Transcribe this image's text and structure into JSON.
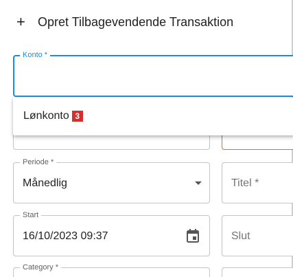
{
  "dialog": {
    "title": "Opret Tilbagevendende Transaktion"
  },
  "form": {
    "konto": {
      "label": "Konto *",
      "value": ""
    },
    "dropdown": {
      "options": [
        {
          "label": "Lønkonto",
          "badge": "3"
        }
      ]
    },
    "periode": {
      "label": "Periode *",
      "value": "Månedlig"
    },
    "titel": {
      "placeholder": "Titel *"
    },
    "start": {
      "label": "Start",
      "value": "16/10/2023 09:37"
    },
    "slut": {
      "placeholder": "Slut"
    },
    "category": {
      "label": "Category *"
    }
  },
  "icons": {
    "title_icon": "plus-icon",
    "periode_icon": "caret-down-icon",
    "start_icon": "calendar-icon"
  },
  "colors": {
    "focus": "#1e88e5",
    "warning_border": "#ef6c00",
    "badge": "#d32f2f"
  }
}
